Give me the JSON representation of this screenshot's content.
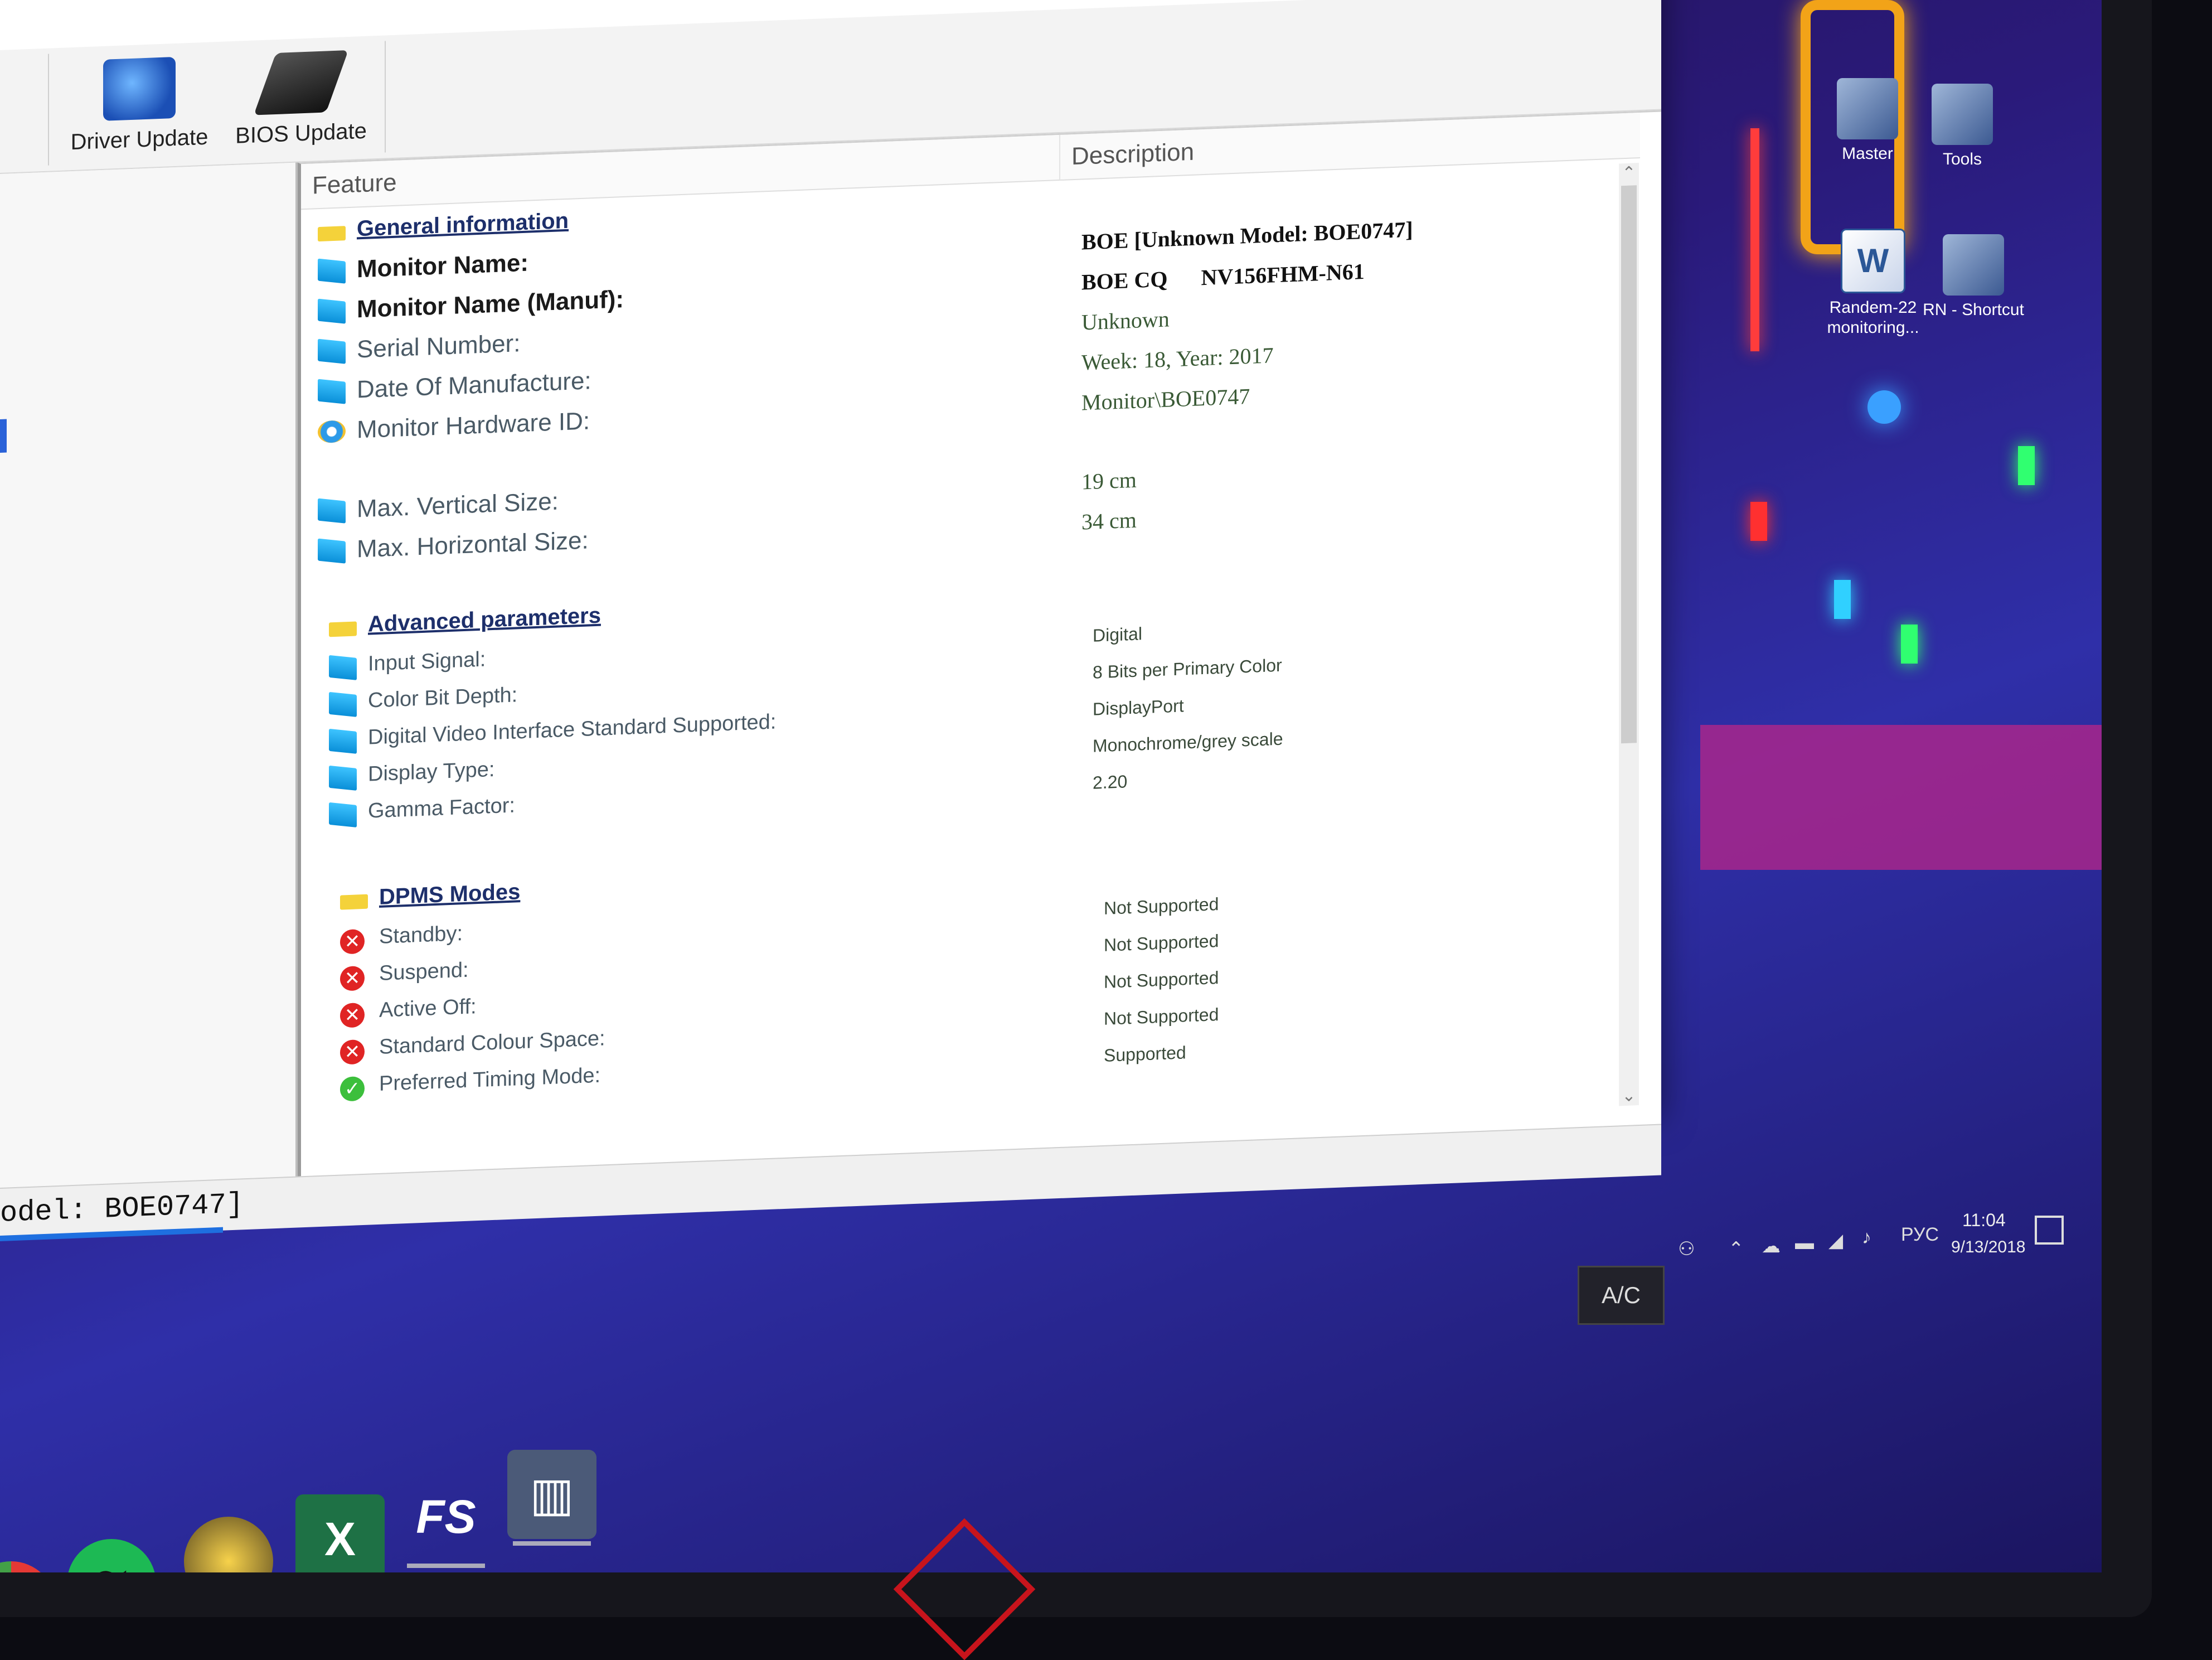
{
  "window": {
    "controls": {
      "minimize": "—",
      "maximize": "☐",
      "close": "✕"
    },
    "toolbar": {
      "driver_update": "Driver Update",
      "bios_update": "BIOS Update"
    },
    "columns": {
      "feature": "Feature",
      "description": "Description"
    },
    "general": {
      "section": "General information",
      "rows": [
        {
          "label": "Monitor Name:",
          "value": "BOE [Unknown Model: BOE0747]",
          "icon": "monitor-icon",
          "bold": true
        },
        {
          "label": "Monitor Name (Manuf):",
          "value": "BOE CQ      NV156FHM-N61",
          "icon": "monitor-icon",
          "bold": true
        },
        {
          "label": "Serial Number:",
          "value": "Unknown",
          "icon": "monitor-icon"
        },
        {
          "label": "Date Of Manufacture:",
          "value": "Week: 18, Year: 2017",
          "icon": "monitor-icon"
        },
        {
          "label": "Monitor Hardware ID:",
          "value": "Monitor\\BOE0747",
          "icon": "gear-icon"
        },
        {
          "label": "Max. Vertical Size:",
          "value": "19 cm",
          "icon": "monitor-icon"
        },
        {
          "label": "Max. Horizontal Size:",
          "value": "34 cm",
          "icon": "monitor-icon"
        }
      ]
    },
    "advanced": {
      "section": "Advanced parameters",
      "rows": [
        {
          "label": "Input Signal:",
          "value": "Digital"
        },
        {
          "label": "Color Bit Depth:",
          "value": "8 Bits per Primary Color"
        },
        {
          "label": "Digital Video Interface Standard Supported:",
          "value": "DisplayPort"
        },
        {
          "label": "Display Type:",
          "value": "Monochrome/grey scale"
        },
        {
          "label": "Gamma Factor:",
          "value": "2.20"
        }
      ]
    },
    "dpms": {
      "section": "DPMS Modes",
      "rows": [
        {
          "label": "Standby:",
          "value": "Not Supported",
          "status": "error"
        },
        {
          "label": "Suspend:",
          "value": "Not Supported",
          "status": "error"
        },
        {
          "label": "Active Off:",
          "value": "Not Supported",
          "status": "error"
        },
        {
          "label": "Standard Colour Space:",
          "value": "Not Supported",
          "status": "error"
        },
        {
          "label": "Preferred Timing Mode:",
          "value": "Supported",
          "status": "ok"
        }
      ]
    },
    "statusbar": "odel: BOE0747]"
  },
  "desktop": {
    "icons": [
      {
        "label": "Master",
        "icon": "master-icon"
      },
      {
        "label": "Tools",
        "icon": "tools-icon"
      },
      {
        "label": "Randem-22 monitoring...",
        "icon": "word-document-icon"
      },
      {
        "label": "RN - Shortcut",
        "icon": "shortcut-icon"
      }
    ]
  },
  "taskbar": {
    "ac_label": "A/C",
    "language": "РУС",
    "time": "11:04",
    "date": "9/13/2018",
    "apps": [
      "chrome-icon",
      "spotify-icon",
      "bee-icon",
      "excel-icon",
      "fs-icon",
      "monitor-tool-icon"
    ],
    "fs_label": "FS"
  },
  "colors": {
    "accent": "#1e6fe0",
    "error": "#e02424",
    "ok": "#3cbf3c",
    "section_link": "#1d2f6b"
  }
}
